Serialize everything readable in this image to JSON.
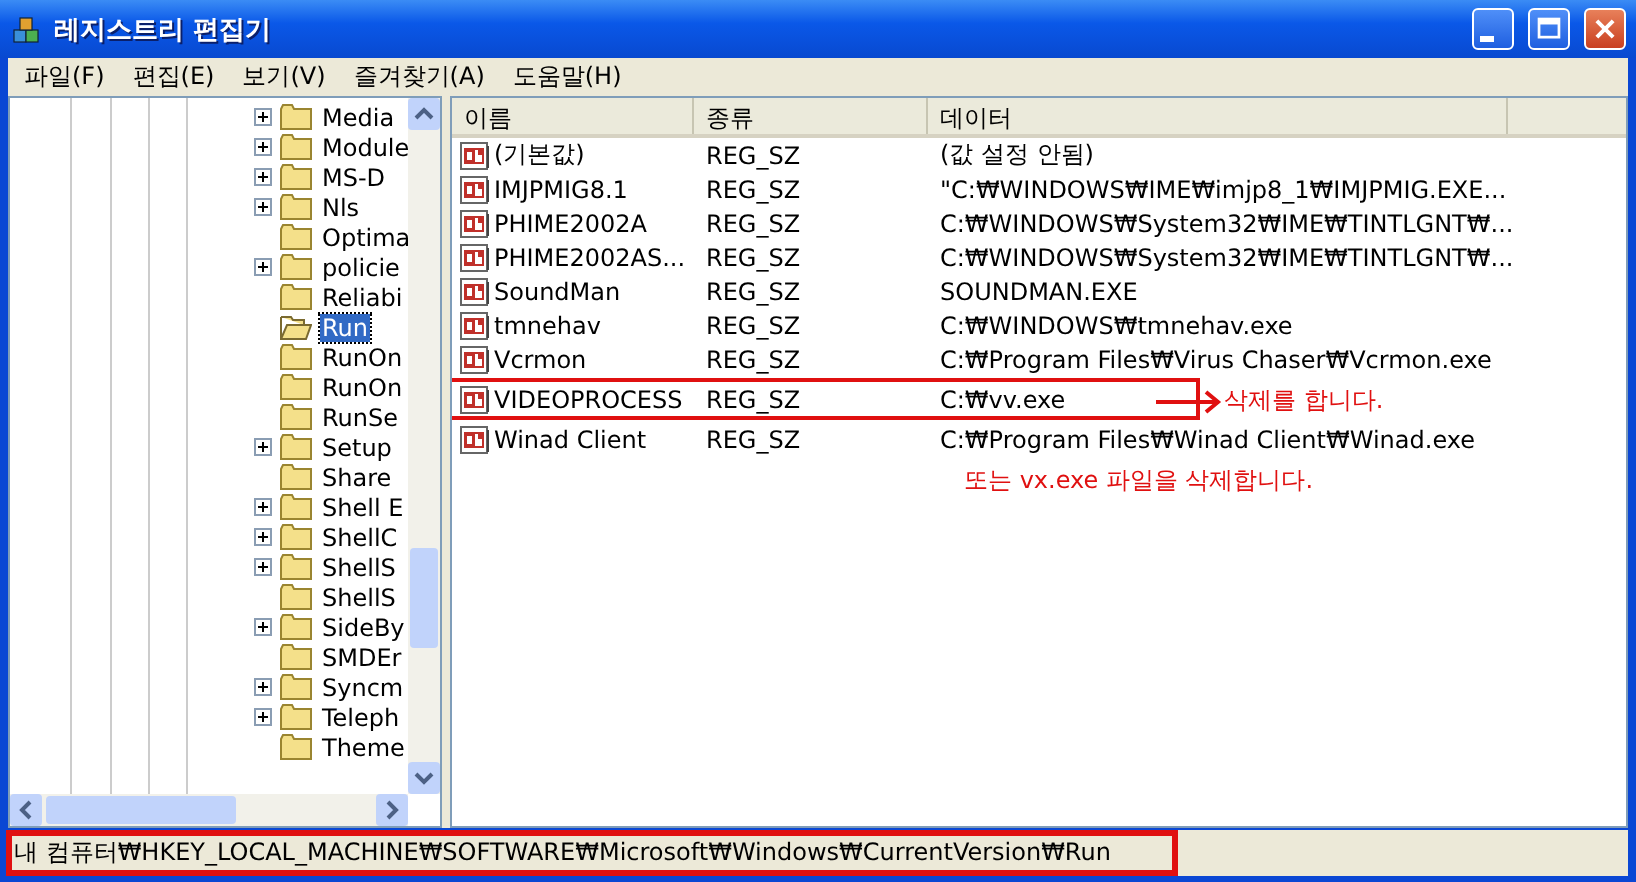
{
  "window": {
    "title": "레지스트리 편집기"
  },
  "menu": [
    "파일(F)",
    "편집(E)",
    "보기(V)",
    "즐겨찾기(A)",
    "도움말(H)"
  ],
  "tree": {
    "items": [
      {
        "label": "Media",
        "expandable": true,
        "selected": false
      },
      {
        "label": "Module",
        "expandable": true,
        "selected": false
      },
      {
        "label": "MS-D",
        "expandable": true,
        "selected": false
      },
      {
        "label": "Nls",
        "expandable": true,
        "selected": false
      },
      {
        "label": "Optima",
        "expandable": false,
        "selected": false
      },
      {
        "label": "policie",
        "expandable": true,
        "selected": false
      },
      {
        "label": "Reliabi",
        "expandable": false,
        "selected": false
      },
      {
        "label": "Run",
        "expandable": false,
        "selected": true
      },
      {
        "label": "RunOn",
        "expandable": false,
        "selected": false
      },
      {
        "label": "RunOn",
        "expandable": false,
        "selected": false
      },
      {
        "label": "RunSe",
        "expandable": false,
        "selected": false
      },
      {
        "label": "Setup",
        "expandable": true,
        "selected": false
      },
      {
        "label": "Share",
        "expandable": false,
        "selected": false
      },
      {
        "label": "Shell E",
        "expandable": true,
        "selected": false
      },
      {
        "label": "ShellC",
        "expandable": true,
        "selected": false
      },
      {
        "label": "ShellS",
        "expandable": true,
        "selected": false
      },
      {
        "label": "ShellS",
        "expandable": false,
        "selected": false
      },
      {
        "label": "SideBy",
        "expandable": true,
        "selected": false
      },
      {
        "label": "SMDEr",
        "expandable": false,
        "selected": false
      },
      {
        "label": "Syncm",
        "expandable": true,
        "selected": false
      },
      {
        "label": "Teleph",
        "expandable": true,
        "selected": false
      },
      {
        "label": "Theme",
        "expandable": false,
        "selected": false
      }
    ]
  },
  "table": {
    "columns": [
      "이름",
      "종류",
      "데이터"
    ],
    "rows": [
      {
        "name": "(기본값)",
        "type": "REG_SZ",
        "data": "(값 설정 안됨)",
        "boxed": false
      },
      {
        "name": "IMJPMIG8.1",
        "type": "REG_SZ",
        "data": "\"C:₩WINDOWS₩IME₩imjp8_1₩IMJPMIG.EXE...",
        "boxed": false
      },
      {
        "name": "PHIME2002A",
        "type": "REG_SZ",
        "data": "C:₩WINDOWS₩System32₩IME₩TINTLGNT₩...",
        "boxed": false
      },
      {
        "name": "PHIME2002AS...",
        "type": "REG_SZ",
        "data": "C:₩WINDOWS₩System32₩IME₩TINTLGNT₩...",
        "boxed": false
      },
      {
        "name": "SoundMan",
        "type": "REG_SZ",
        "data": "SOUNDMAN.EXE",
        "boxed": false
      },
      {
        "name": "tmnehav",
        "type": "REG_SZ",
        "data": "C:₩WINDOWS₩tmnehav.exe",
        "boxed": false
      },
      {
        "name": "Vcrmon",
        "type": "REG_SZ",
        "data": "C:₩Program Files₩Virus Chaser₩Vcrmon.exe",
        "boxed": false
      },
      {
        "name": "VIDEOPROCESS",
        "type": "REG_SZ",
        "data": "C:₩vv.exe",
        "boxed": true,
        "note": "삭제를 합니다."
      },
      {
        "name": "Winad Client",
        "type": "REG_SZ",
        "data": "C:₩Program Files₩Winad Client₩Winad.exe",
        "boxed": false
      }
    ],
    "footnote": "또는 vx.exe 파일을 삭제합니다."
  },
  "status_bar": {
    "text": "내 컴퓨터₩HKEY_LOCAL_MACHINE₩SOFTWARE₩Microsoft₩Windows₩CurrentVersion₩Run",
    "boxed": true
  }
}
